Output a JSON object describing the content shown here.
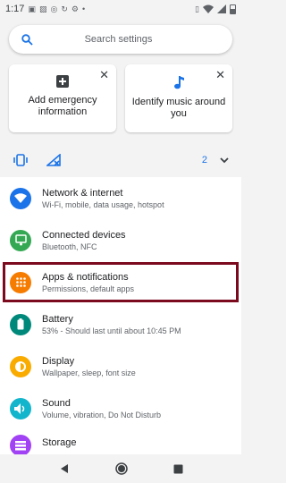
{
  "status_bar": {
    "time": "1:17",
    "left_icons": [
      "sim-icon",
      "photo-icon",
      "whatsapp-icon",
      "sync-icon",
      "settings-gear-icon",
      "dot-icon"
    ],
    "right_icons": [
      "vibrate-icon",
      "wifi-icon",
      "signal-icon",
      "battery-icon"
    ]
  },
  "search": {
    "placeholder": "Search settings"
  },
  "suggestions": [
    {
      "label": "Add emergency information",
      "icon": "plus-box-icon"
    },
    {
      "label": "Identify music around you",
      "icon": "music-note-icon"
    }
  ],
  "conditions": {
    "count": "2",
    "icons": [
      "vibrate-icon",
      "no-signal-icon"
    ]
  },
  "colors": {
    "network": "#1a73e8",
    "devices": "#34a853",
    "apps": "#f57c00",
    "battery": "#00897b",
    "display": "#f9ab00",
    "sound": "#12b5cb",
    "storage": "#a142f4",
    "highlight": "#7b0a1e",
    "accent": "#1a73e8"
  },
  "settings": [
    {
      "title": "Network & internet",
      "subtitle": "Wi-Fi, mobile, data usage, hotspot",
      "icon": "wifi-icon"
    },
    {
      "title": "Connected devices",
      "subtitle": "Bluetooth, NFC",
      "icon": "devices-icon"
    },
    {
      "title": "Apps & notifications",
      "subtitle": "Permissions, default apps",
      "icon": "apps-icon"
    },
    {
      "title": "Battery",
      "subtitle": "53% - Should last until about 10:45 PM",
      "icon": "battery-icon"
    },
    {
      "title": "Display",
      "subtitle": "Wallpaper, sleep, font size",
      "icon": "brightness-icon"
    },
    {
      "title": "Sound",
      "subtitle": "Volume, vibration, Do Not Disturb",
      "icon": "volume-icon"
    },
    {
      "title": "Storage",
      "subtitle": "",
      "icon": "storage-icon"
    }
  ],
  "nav": [
    "back-icon",
    "home-icon",
    "recents-icon"
  ]
}
